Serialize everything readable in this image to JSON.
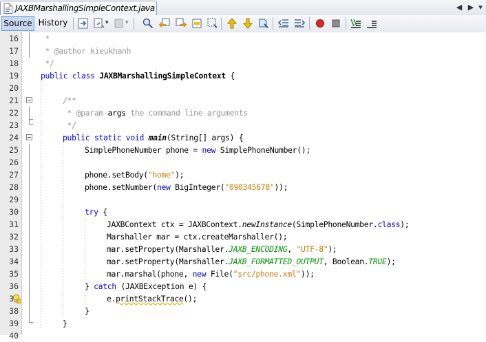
{
  "tab": {
    "title": "JAXBMarshallingSimpleContext.java",
    "close_glyph": "×",
    "scroll_left": "◀",
    "scroll_right": "▶"
  },
  "toolbar": {
    "source_label": "Source",
    "history_label": "History",
    "icons": [
      "last-edit-icon",
      "back-icon",
      "forward-icon",
      "find-icon",
      "find-previous-icon",
      "find-next-icon",
      "toggle-highlight-icon",
      "toggle-rect-selection-icon",
      "previous-bookmark-icon",
      "next-bookmark-icon",
      "toggle-bookmark-icon",
      "shift-left-icon",
      "shift-right-icon",
      "start-macro-icon",
      "stop-macro-icon",
      "comment-icon",
      "uncomment-icon"
    ]
  },
  "lines": [
    {
      "n": "16"
    },
    {
      "n": "17"
    },
    {
      "n": "18"
    },
    {
      "n": "19"
    },
    {
      "n": "20"
    },
    {
      "n": "21"
    },
    {
      "n": "22"
    },
    {
      "n": "23"
    },
    {
      "n": "24"
    },
    {
      "n": "25"
    },
    {
      "n": "26"
    },
    {
      "n": "27"
    },
    {
      "n": "28"
    },
    {
      "n": "29"
    },
    {
      "n": "30"
    },
    {
      "n": "31"
    },
    {
      "n": "32"
    },
    {
      "n": "33"
    },
    {
      "n": "34"
    },
    {
      "n": "35"
    },
    {
      "n": "36"
    },
    {
      "n": "37"
    },
    {
      "n": "38"
    },
    {
      "n": "39"
    },
    {
      "n": "40"
    }
  ],
  "code": {
    "l16": " *",
    "l17": " * @author kieukhanh",
    "l18": " */",
    "l19_kw": "public class ",
    "l19_name": "JAXBMarshallingSimpleContext",
    "l19_rest": " {",
    "l21": "/**",
    "l22_a": " * @param ",
    "l22_b": "args",
    "l22_c": " the command line arguments",
    "l23": " */",
    "l24_kw": "public static void ",
    "l24_name": "main",
    "l24_rest": "(String[] args) {",
    "l25_a": "SimplePhoneNumber phone = ",
    "l25_kw": "new",
    "l25_b": " SimplePhoneNumber();",
    "l27_a": "phone.setBody(",
    "l27_s": "\"home\"",
    "l27_b": ");",
    "l28_a": "phone.setNumber(",
    "l28_kw": "new",
    "l28_b": " BigInteger(",
    "l28_s": "\"090345678\"",
    "l28_c": "));",
    "l30_kw": "try",
    "l30_rest": " {",
    "l31_a": "JAXBContext ctx = JAXBContext.",
    "l31_it": "newInstance",
    "l31_b": "(SimplePhoneNumber.",
    "l31_kw": "class",
    "l31_c": ");",
    "l32": "Marshaller mar = ctx.createMarshaller();",
    "l33_a": "mar.setProperty(Marshaller.",
    "l33_f": "JAXB_ENCODING",
    "l33_b": ", ",
    "l33_s": "\"UTF-8\"",
    "l33_c": ");",
    "l34_a": "mar.setProperty(Marshaller.",
    "l34_f": "JAXB_FORMATTED_OUTPUT",
    "l34_b": ", Boolean.",
    "l34_f2": "TRUE",
    "l34_c": ");",
    "l35_a": "mar.marshal(phone, ",
    "l35_kw": "new",
    "l35_b": " File(",
    "l35_s": "\"src/phone.xml\"",
    "l35_c": "));",
    "l36_a": "} ",
    "l36_kw": "catch",
    "l36_b": " (JAXBException e) {",
    "l37_a": "e.",
    "l37_w": "printStackTrace",
    "l37_b": "();",
    "l38": "}",
    "l39": "}"
  },
  "colors": {
    "keyword": "#0000e6",
    "comment": "#969696",
    "string": "#ce7b00",
    "field": "#009900"
  }
}
